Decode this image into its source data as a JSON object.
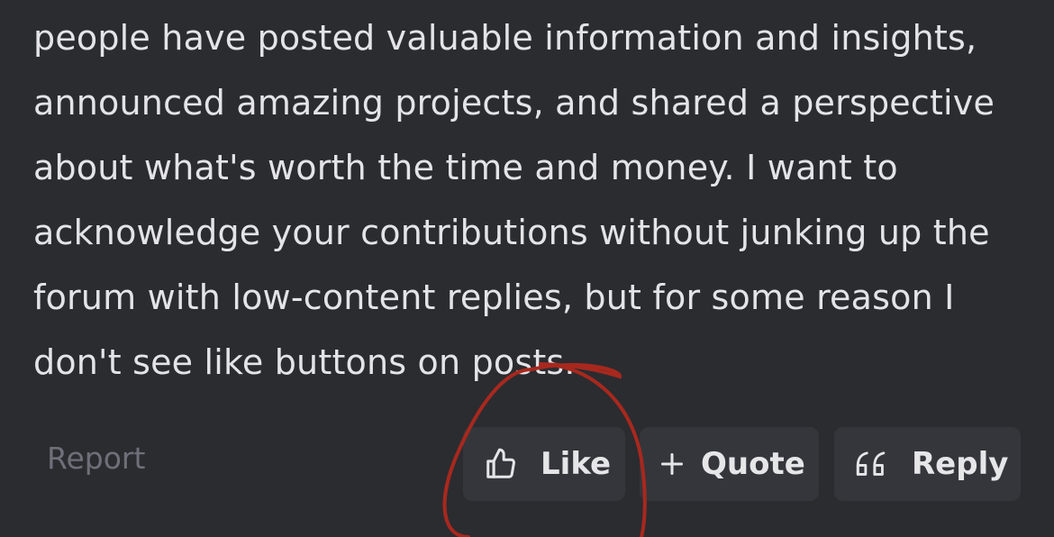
{
  "post": {
    "lines": [
      "people have posted valuable information and insights,",
      "announced amazing projects, and shared a perspective",
      "about what's worth the time and money. I want to",
      "acknowledge your contributions without junking up the",
      "forum with low-content replies, but for some reason I",
      "don't see like buttons on posts."
    ]
  },
  "actions": {
    "report_label": "Report",
    "like_label": "Like",
    "quote_label": "Quote",
    "reply_label": "Reply"
  },
  "icons": {
    "like": "thumbs-up-icon",
    "quote": "plus-icon",
    "reply": "quote-marks-icon"
  },
  "colors": {
    "background": "#2b2c30",
    "text": "#e4e4e7",
    "muted": "#6e7079",
    "button_bg": "#35363b",
    "annotation": "#a8281e"
  }
}
